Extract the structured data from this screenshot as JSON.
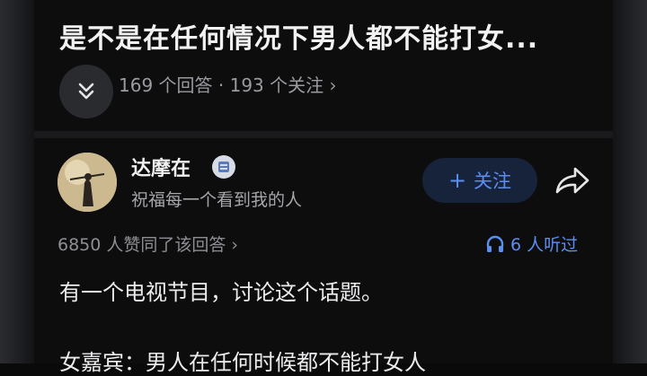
{
  "question": {
    "title": "是不是在任何情况下男人都不能打女...",
    "meta": "169 个回答 · 193 个关注 ›"
  },
  "answer": {
    "author_name": "达摩在",
    "author_bio": "祝福每一个看到我的人",
    "follow_label": "关注",
    "likes_text": "6850 人赞同了该回答 ›",
    "listen_text": "6 人听过",
    "body_lines": [
      "有一个电视节目，讨论这个话题。",
      "女嘉宾：男人在任何时候都不能打女人"
    ]
  },
  "icons": {
    "collapse": "chevron-double-down-icon",
    "badge": "verified-badge-icon",
    "share": "share-arrow-icon",
    "listen": "headphones-icon"
  },
  "colors": {
    "accent": "#5a8ff0",
    "background": "#0d0d0e"
  }
}
